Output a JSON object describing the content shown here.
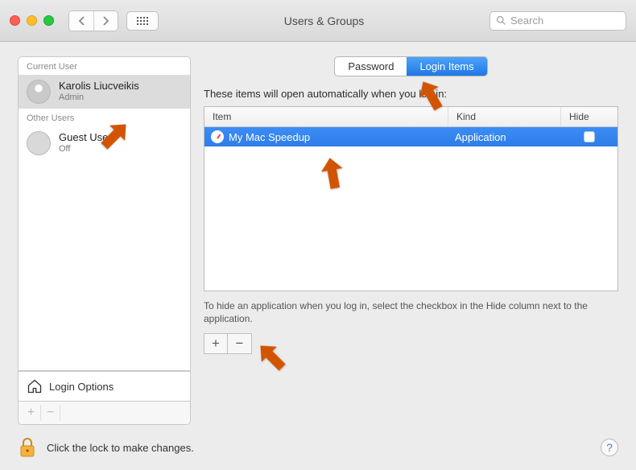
{
  "window": {
    "title": "Users & Groups"
  },
  "search": {
    "placeholder": "Search"
  },
  "sidebar": {
    "section_current": "Current User",
    "section_other": "Other Users",
    "current_user": {
      "name": "Karolis Liucveikis",
      "role": "Admin"
    },
    "guest": {
      "name": "Guest User",
      "status": "Off"
    },
    "login_options_label": "Login Options"
  },
  "tabs": {
    "password": "Password",
    "login_items": "Login Items"
  },
  "main": {
    "lead": "These items will open automatically when you log in:",
    "col_item": "Item",
    "col_kind": "Kind",
    "col_hide": "Hide",
    "rows": [
      {
        "label": "My Mac Speedup",
        "kind": "Application",
        "hide": false
      }
    ],
    "hint": "To hide an application when you log in, select the checkbox in the Hide column next to the application.",
    "add": "+",
    "remove": "−"
  },
  "lock": {
    "text": "Click the lock to make changes."
  },
  "help": {
    "label": "?"
  },
  "colors": {
    "accent": "#2f7de8",
    "arrow": "#d35400"
  }
}
